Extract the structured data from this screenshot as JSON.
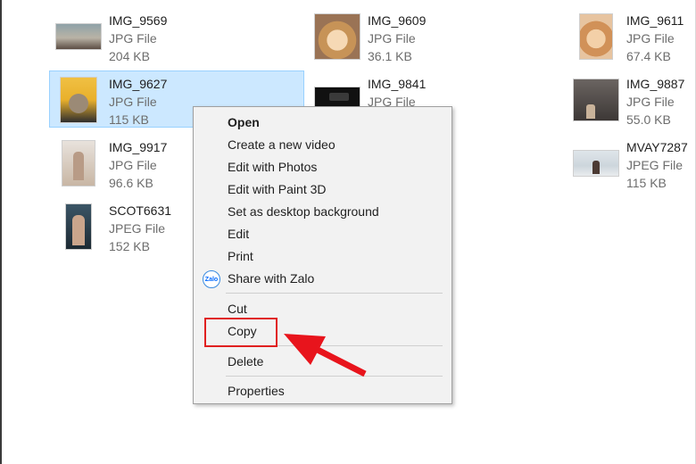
{
  "files": [
    {
      "id": "img9569",
      "name": "IMG_9569",
      "type": "JPG File",
      "size": "204 KB",
      "selected": false
    },
    {
      "id": "img9609",
      "name": "IMG_9609",
      "type": "JPG File",
      "size": "36.1 KB",
      "selected": false
    },
    {
      "id": "img9611",
      "name": "IMG_9611",
      "type": "JPG File",
      "size": "67.4 KB",
      "selected": false
    },
    {
      "id": "img9627",
      "name": "IMG_9627",
      "type": "JPG File",
      "size": "115 KB",
      "selected": true
    },
    {
      "id": "img9841",
      "name": "IMG_9841",
      "type": "JPG File",
      "size": "",
      "selected": false
    },
    {
      "id": "img9887",
      "name": "IMG_9887",
      "type": "JPG File",
      "size": "55.0 KB",
      "selected": false
    },
    {
      "id": "img9917",
      "name": "IMG_9917",
      "type": "JPG File",
      "size": "96.6 KB",
      "selected": false
    },
    {
      "id": "mvay7287",
      "name": "MVAY7287",
      "type": "JPEG File",
      "size": "115 KB",
      "selected": false
    },
    {
      "id": "scot6631",
      "name": "SCOT6631",
      "type": "JPEG File",
      "size": "152 KB",
      "selected": false
    }
  ],
  "context_menu": {
    "items": [
      {
        "label": "Open",
        "bold": true
      },
      {
        "label": "Create a new video"
      },
      {
        "label": "Edit with Photos"
      },
      {
        "label": "Edit with Paint 3D"
      },
      {
        "label": "Set as desktop background"
      },
      {
        "label": "Edit"
      },
      {
        "label": "Print"
      },
      {
        "label": "Share with Zalo",
        "icon": "zalo-icon",
        "icon_text": "Zalo"
      },
      {
        "label": "Cut"
      },
      {
        "label": "Copy",
        "highlighted": true
      },
      {
        "label": "Delete"
      },
      {
        "label": "Properties"
      }
    ]
  },
  "annotation": {
    "highlight_color": "#e02020",
    "arrow_color": "#e8141c",
    "points_to": "Copy"
  },
  "colors": {
    "selection_bg": "#cce8ff",
    "selection_border": "#99d1ff",
    "menu_bg": "#f2f2f2"
  }
}
